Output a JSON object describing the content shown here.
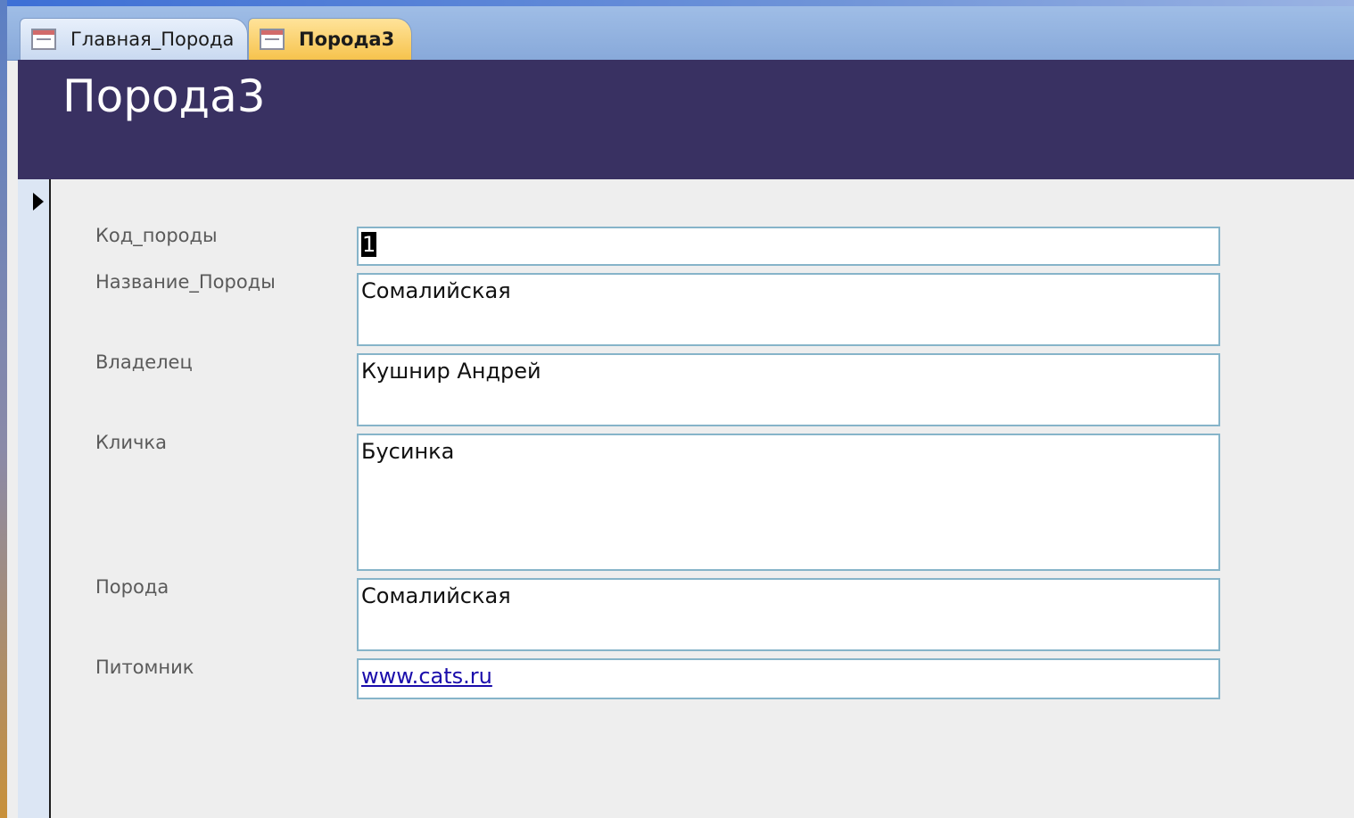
{
  "tabs": [
    {
      "label": "Главная_Порода",
      "icon": "form-icon",
      "active": false
    },
    {
      "label": "Порода3",
      "icon": "form-icon",
      "active": true
    }
  ],
  "form": {
    "title": "Порода3",
    "fields": [
      {
        "label": "Код_породы",
        "value": "1"
      },
      {
        "label": "Название_Породы",
        "value": "Сомалийская"
      },
      {
        "label": "Владелец",
        "value": "Кушнир Андрей"
      },
      {
        "label": "Кличка",
        "value": "Бусинка"
      },
      {
        "label": "Порода",
        "value": "Сомалийская"
      },
      {
        "label": "Питомник",
        "value": "www.cats.ru"
      }
    ]
  },
  "colors": {
    "header_bg": "#393162",
    "active_tab": "#f6c34d",
    "field_border": "#86b4c9",
    "link": "#1a0dab"
  }
}
